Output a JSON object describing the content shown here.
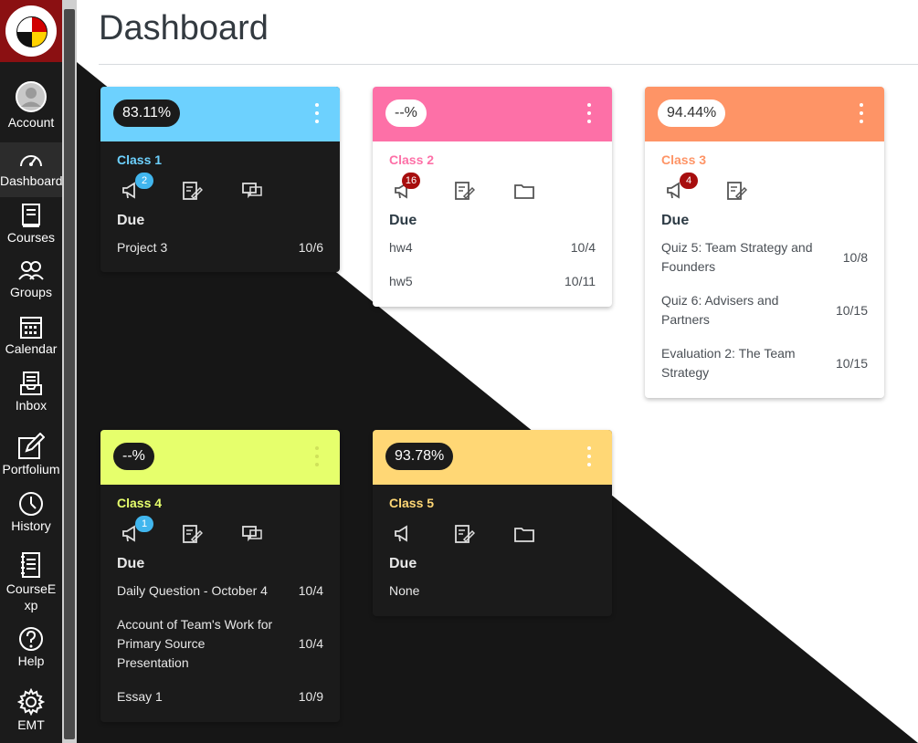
{
  "page": {
    "title": "Dashboard"
  },
  "nav": {
    "logo_alt": "University of Maryland seal",
    "items": [
      {
        "label": "Account",
        "icon": "account-icon"
      },
      {
        "label": "Dashboard",
        "icon": "dashboard-icon",
        "active": true
      },
      {
        "label": "Courses",
        "icon": "courses-icon"
      },
      {
        "label": "Groups",
        "icon": "groups-icon"
      },
      {
        "label": "Calendar",
        "icon": "calendar-icon"
      },
      {
        "label": "Inbox",
        "icon": "inbox-icon"
      },
      {
        "label": "Portfolium",
        "icon": "portfolium-icon"
      },
      {
        "label": "History",
        "icon": "history-icon"
      },
      {
        "label": "CourseExp",
        "icon": "courseexp-icon"
      },
      {
        "label": "Help",
        "icon": "help-icon"
      },
      {
        "label": "EMT",
        "icon": "emt-icon"
      }
    ]
  },
  "cards": [
    {
      "name": "Class 1",
      "grade": "83.11%",
      "color": "#6dd1fe",
      "badge": "2",
      "due_label": "Due",
      "due": [
        {
          "name": "Project 3",
          "date": "10/6"
        }
      ]
    },
    {
      "name": "Class 2",
      "grade": "--%",
      "color": "#fd70a7",
      "badge": "16",
      "due_label": "Due",
      "due": [
        {
          "name": "hw4",
          "date": "10/4"
        },
        {
          "name": "hw5",
          "date": "10/11"
        }
      ]
    },
    {
      "name": "Class 3",
      "grade": "94.44%",
      "color": "#fe9466",
      "badge": "4",
      "due_label": "Due",
      "due": [
        {
          "name": "Quiz 5: Team Strategy and Founders",
          "date": "10/8"
        },
        {
          "name": "Quiz 6: Advisers and Partners",
          "date": "10/15"
        },
        {
          "name": "Evaluation 2: The Team Strategy",
          "date": "10/15"
        }
      ]
    },
    {
      "name": "Class 4",
      "grade": "--%",
      "color": "#e6ff6c",
      "badge": "1",
      "due_label": "Due",
      "due": [
        {
          "name": "Daily Question - October 4",
          "date": "10/4"
        },
        {
          "name": "Account of Team's Work for Primary Source Presentation",
          "date": "10/4"
        },
        {
          "name": "Essay 1",
          "date": "10/9"
        }
      ]
    },
    {
      "name": "Class 5",
      "grade": "93.78%",
      "color": "#ffd775",
      "badge": "",
      "due_label": "Due",
      "due": [
        {
          "name": "None",
          "date": ""
        }
      ]
    }
  ]
}
